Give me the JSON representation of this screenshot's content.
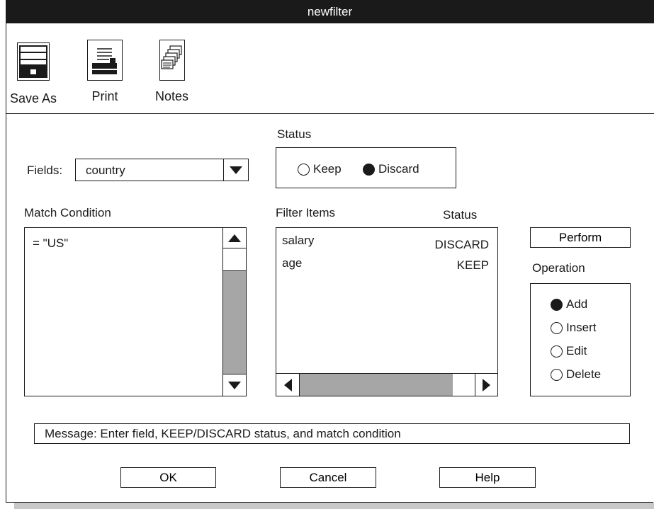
{
  "window": {
    "title": "newfilter"
  },
  "toolbar": {
    "items": [
      {
        "label": "Save As",
        "icon": "floppy-disk-icon"
      },
      {
        "label": "Print",
        "icon": "printer-icon"
      },
      {
        "label": "Notes",
        "icon": "notes-stack-icon"
      }
    ]
  },
  "fields": {
    "label": "Fields:",
    "value": "country"
  },
  "status": {
    "label": "Status",
    "options": [
      {
        "label": "Keep",
        "selected": false
      },
      {
        "label": "Discard",
        "selected": true
      }
    ]
  },
  "match_condition": {
    "label": "Match Condition",
    "value": "= \"US\""
  },
  "filter_items": {
    "label": "Filter Items",
    "status_header": "Status",
    "rows": [
      {
        "name": "salary",
        "status": "DISCARD"
      },
      {
        "name": "age",
        "status": "KEEP"
      }
    ]
  },
  "perform": {
    "label": "Perform"
  },
  "operation": {
    "label": "Operation",
    "options": [
      {
        "label": "Add",
        "selected": true
      },
      {
        "label": "Insert",
        "selected": false
      },
      {
        "label": "Edit",
        "selected": false
      },
      {
        "label": "Delete",
        "selected": false
      }
    ]
  },
  "message": "Message: Enter field, KEEP/DISCARD status, and match condition",
  "buttons": {
    "ok": "OK",
    "cancel": "Cancel",
    "help": "Help"
  },
  "colors": {
    "titlebar": "#1a1a1a",
    "scrollbar_track": "#a6a6a6",
    "shadow": "#c8c8c8"
  }
}
